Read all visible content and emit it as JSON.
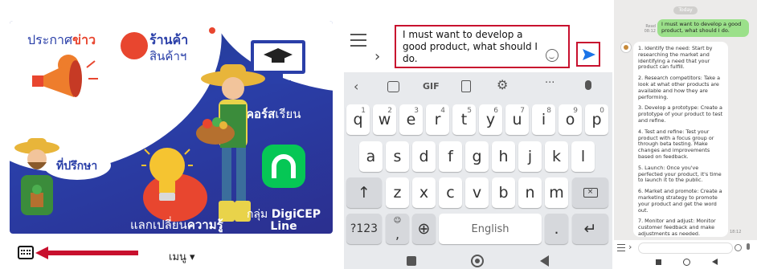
{
  "panel1": {
    "announcement_prefix": "ประกาศ",
    "announcement_bold": "ข่าว",
    "shop_bold": "ร้านค้า",
    "shop_sub": "สินค้าฯ",
    "course_bold": "คอร์ส",
    "course_reg": "เรียน",
    "advisor": "ที่ปรึกษา",
    "exchange_reg": "แลกเปลี่ยน",
    "exchange_bold": "ความรู้",
    "group_prefix": "กลุ่ม ",
    "group_name": "DigiCEP",
    "group_line": "Line",
    "menu_label": "เมนู ▾",
    "accent_red": "#c8102e"
  },
  "panel2": {
    "input_text": "I must want to develop a good product, what should I do.",
    "toolbar_gif": "GIF",
    "row1": [
      {
        "k": "q",
        "n": "1"
      },
      {
        "k": "w",
        "n": "2"
      },
      {
        "k": "e",
        "n": "3"
      },
      {
        "k": "r",
        "n": "4"
      },
      {
        "k": "t",
        "n": "5"
      },
      {
        "k": "y",
        "n": "6"
      },
      {
        "k": "u",
        "n": "7"
      },
      {
        "k": "i",
        "n": "8"
      },
      {
        "k": "o",
        "n": "9"
      },
      {
        "k": "p",
        "n": "0"
      }
    ],
    "row2": [
      "a",
      "s",
      "d",
      "f",
      "g",
      "h",
      "j",
      "k",
      "l"
    ],
    "row3": [
      "z",
      "x",
      "c",
      "v",
      "b",
      "n",
      "m"
    ],
    "mode_key": "?123",
    "comma_key": ",",
    "space_label": "English",
    "period_key": ".",
    "send_color": "#1a73e8"
  },
  "panel3": {
    "date": "Today",
    "read_label": "Read",
    "sent_time": "08:12",
    "user_message": "I must want to develop a good product, what should I do.",
    "reply_time": "18:12",
    "reply_items": [
      "1. Identify the need: Start by researching the market and identifying a need that your product can fulfill.",
      "2. Research competitors: Take a look at what other products are available and how they are performing.",
      "3. Develop a prototype: Create a prototype of your product to test and refine.",
      "4. Test and refine: Test your product with a focus group or through beta testing. Make changes and improvements based on feedback.",
      "5. Launch: Once you've perfected your product, it's time to launch it to the public.",
      "6. Market and promote: Create a marketing strategy to promote your product and get the word out.",
      "7. Monitor and adjust: Monitor customer feedback and make adjustments as needed."
    ]
  }
}
